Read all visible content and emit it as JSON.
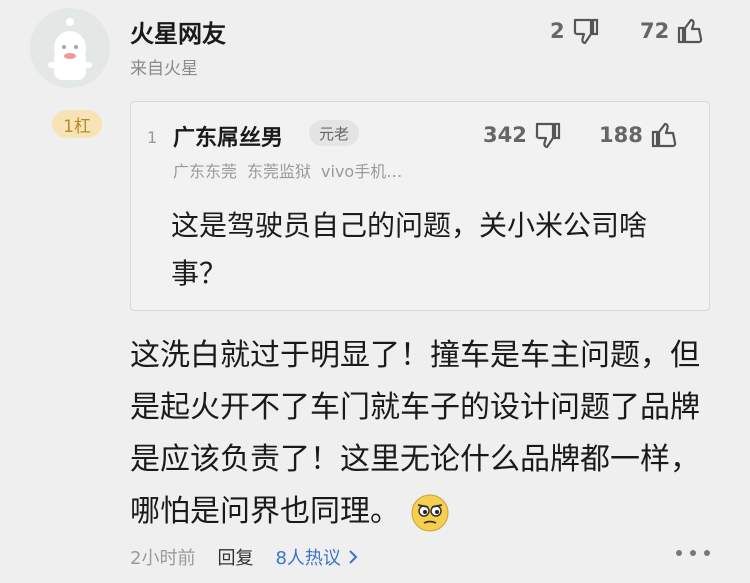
{
  "comment": {
    "username": "火星网友",
    "source": "来自火星",
    "dislike_count": "2",
    "like_count": "72",
    "floor_label": "1杠",
    "quote": {
      "index": "1",
      "username": "广东屌丝男",
      "badge": "元老",
      "dislike_count": "342",
      "like_count": "188",
      "meta": [
        "广东东莞",
        "东莞监狱",
        "vivo手机…"
      ],
      "text": "这是驾驶员自己的问题，关小米公司啥事？"
    },
    "text": "这洗白就过于明显了！撞车是车主问题，但是起火开不了车门就车子的设计问题了品牌是应该负责了！这里无论什么品牌都一样，哪怕是问界也同理。",
    "footer": {
      "time": "2小时前",
      "reply": "回复",
      "hot": "8人热议",
      "hot_color": "#3b74c8"
    }
  },
  "icons": [
    "avatar",
    "thumb-down-icon",
    "thumb-up-icon",
    "chevron-right-icon",
    "more-icon",
    "emoji-icon"
  ]
}
